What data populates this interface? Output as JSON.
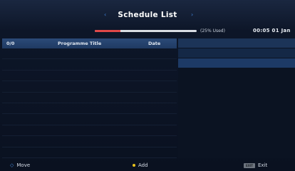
{
  "header": {
    "title": "Schedule List",
    "left_arrow": "‹",
    "right_arrow": "›"
  },
  "status": {
    "usage_text": "(25% Used)",
    "usage_percent": 25,
    "clock": "00:05 01 Jan"
  },
  "list": {
    "columns": {
      "count": "0/0",
      "title": "Programme Title",
      "date": "Date"
    },
    "rows": []
  },
  "footer": {
    "move_label": "Move",
    "add_label": "Add",
    "exit_key": "EXIT",
    "exit_label": "Exit"
  },
  "colors": {
    "accent": "#3f7fd6",
    "usage_fill": "#e04848",
    "add_dot": "#e8c21c",
    "header_bg": "#2b4a78"
  }
}
